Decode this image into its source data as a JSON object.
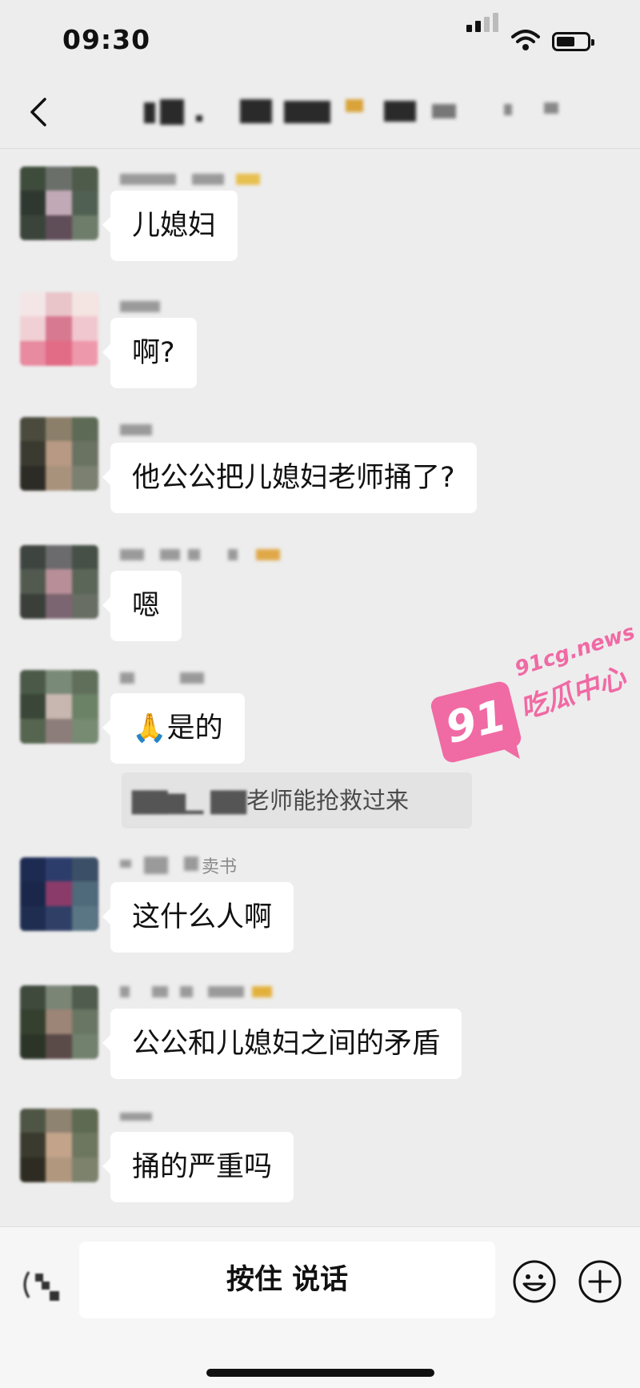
{
  "status_bar": {
    "time": "09:30"
  },
  "nav": {
    "back_icon": "chevron-left-icon"
  },
  "messages": [
    {
      "text": "儿媳妇"
    },
    {
      "text": "啊?"
    },
    {
      "text": "他公公把儿媳妇老师捅了?"
    },
    {
      "text": "嗯"
    },
    {
      "emoji": "🙏",
      "text": "是的",
      "quote": "老师能抢救过来"
    },
    {
      "sender_visible": "卖书",
      "text": "这什么人啊"
    },
    {
      "text": "公公和儿媳妇之间的矛盾"
    },
    {
      "text": "捅的严重吗"
    }
  ],
  "watermark": {
    "badge": "91",
    "url": "91cg.news",
    "name": "吃瓜中心",
    "color": "#f06aa4"
  },
  "input_bar": {
    "hold_to_talk": "按住 说话",
    "voice_icon": "voice-input-icon",
    "emoji_icon": "emoji-icon",
    "plus_icon": "plus-icon"
  }
}
